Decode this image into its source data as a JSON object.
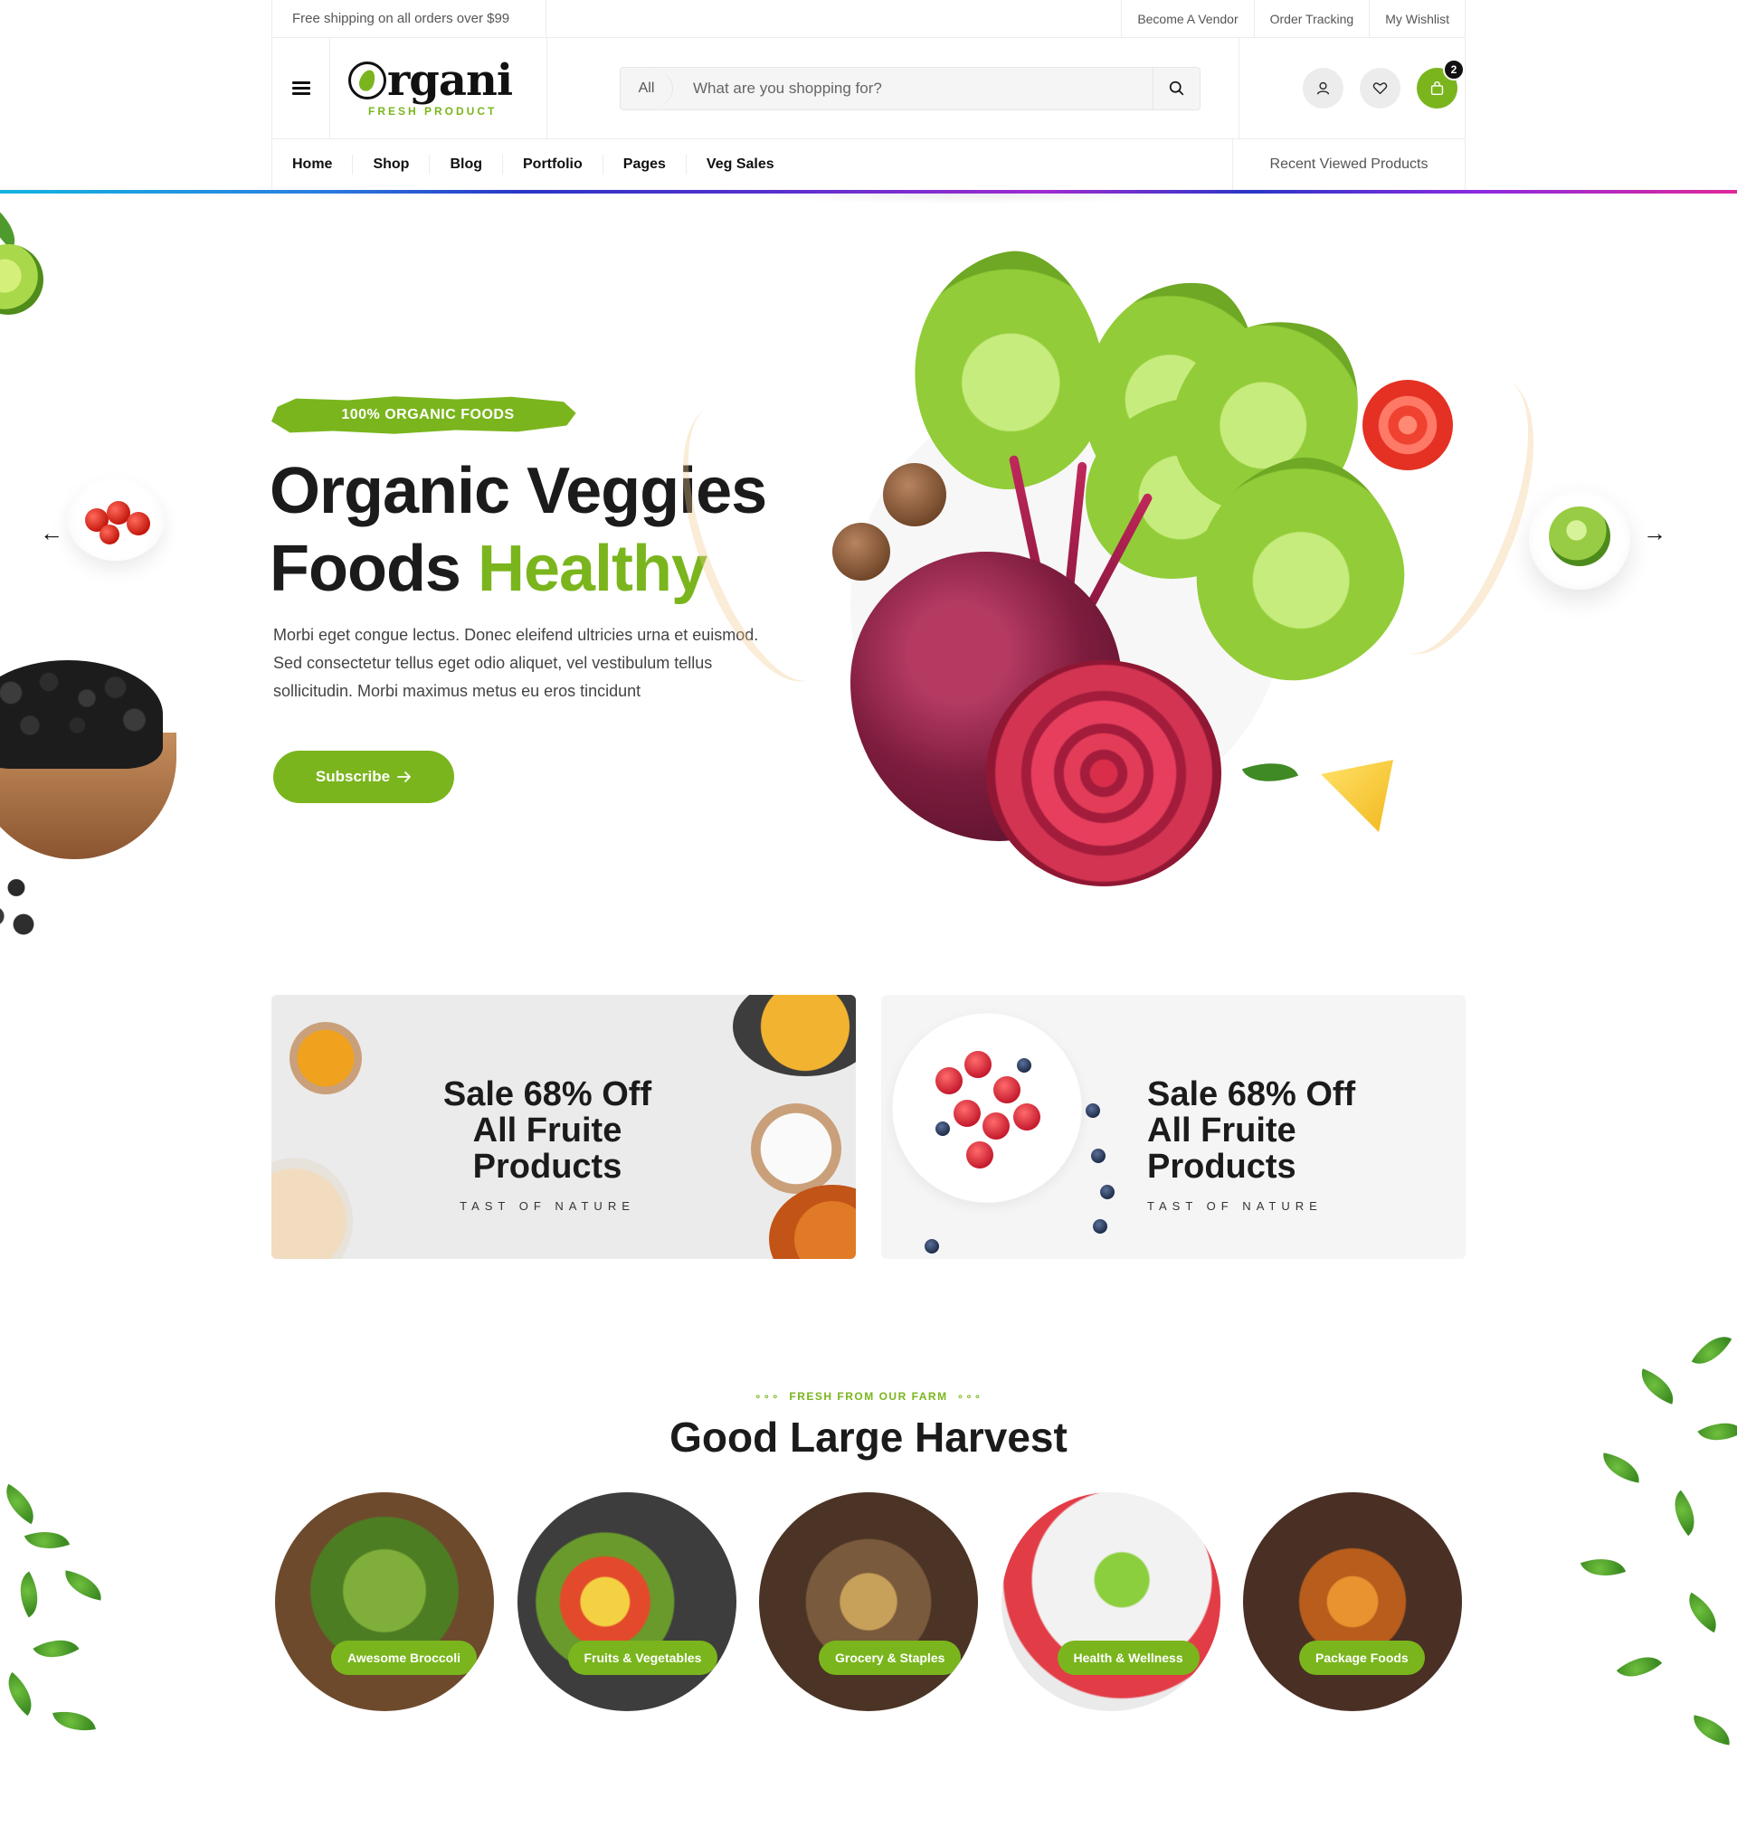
{
  "topbar": {
    "shipping": "Free shipping on all orders over $99",
    "links": [
      "Become A Vendor",
      "Order Tracking",
      "My Wishlist"
    ]
  },
  "header": {
    "logo_word": "rgani",
    "logo_tag": "FRESH PRODUCT",
    "search_category": "All",
    "search_placeholder": "What are you shopping for?",
    "cart_count": "2",
    "icons": [
      "menu-icon",
      "search-icon",
      "user-icon",
      "heart-icon",
      "bag-icon"
    ]
  },
  "nav": {
    "items": [
      "Home",
      "Shop",
      "Blog",
      "Portfolio",
      "Pages",
      "Veg Sales"
    ],
    "recent": "Recent Viewed Products"
  },
  "hero": {
    "badge": "100% ORGANIC FOODS",
    "title_line1": "Organic Veggies",
    "title_line2_dark": "Foods ",
    "title_line2_green": "Healthy",
    "description": "Morbi eget congue lectus. Donec eleifend ultricies urna et euismod. Sed consectetur tellus eget odio aliquet, vel vestibulum tellus sollicitudin. Morbi maximus metus eu eros tincidunt",
    "button": "Subscribe",
    "prev_arrow": "←",
    "next_arrow": "→"
  },
  "promos": [
    {
      "line1": "Sale 68% Off",
      "line2": "All Fruite Products",
      "tagline": "TAST OF NATURE"
    },
    {
      "line1": "Sale 68% Off",
      "line2": "All Fruite Products",
      "tagline": "TAST OF NATURE"
    }
  ],
  "harvest": {
    "kicker": "FRESH FROM OUR FARM",
    "title": "Good Large Harvest",
    "categories": [
      "Awesome Broccoli",
      "Fruits & Vegetables",
      "Grocery & Staples",
      "Health & Wellness",
      "Package Foods"
    ]
  },
  "colors": {
    "accent": "#7ab51d",
    "text": "#1b1b1b",
    "muted": "#555555"
  }
}
